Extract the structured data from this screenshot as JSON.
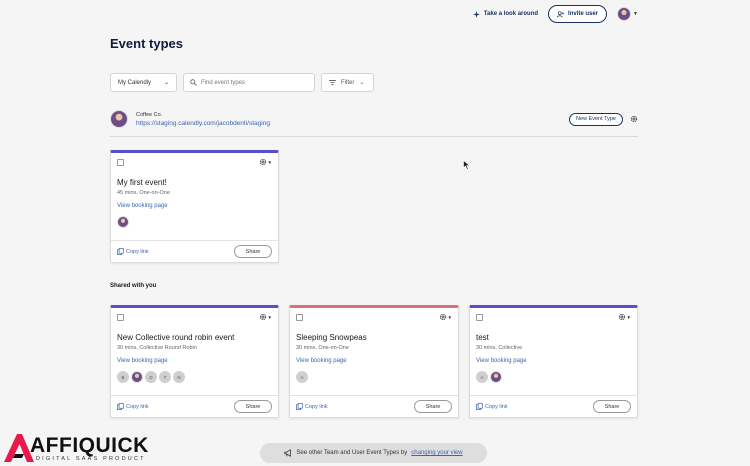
{
  "topbar": {
    "tour_label": "Take a look around",
    "invite_label": "Invite user"
  },
  "page": {
    "title": "Event types"
  },
  "filters": {
    "scope_value": "My Calendly",
    "search_placeholder": "Find event types",
    "filter_label": "Filter"
  },
  "profile": {
    "name": "Coffee Co.",
    "link": "https://staging.calendly.com/jacobdenti/staging",
    "new_event_label": "New Event Type"
  },
  "my_events": [
    {
      "title": "My first event!",
      "meta": "45 mins, One-on-One",
      "booking_label": "View booking page",
      "copy_label": "Copy link",
      "share_label": "Share",
      "accent": "#5b4fc9"
    }
  ],
  "shared": {
    "label": "Shared with you",
    "events": [
      {
        "title": "New Collective round robin event",
        "meta": "30 mins, Collective Round Robin",
        "booking_label": "View booking page",
        "people": [
          "B",
          "",
          "D",
          "T",
          "N"
        ],
        "copy_label": "Copy link",
        "share_label": "Share",
        "accent": "#5b4fc9"
      },
      {
        "title": "Sleeping Snowpeas",
        "meta": "30 mins, One-on-One",
        "booking_label": "View booking page",
        "people": [
          "A"
        ],
        "copy_label": "Copy link",
        "share_label": "Share",
        "accent": "#d9707a"
      },
      {
        "title": "test",
        "meta": "30 mins, Collective",
        "booking_label": "View booking page",
        "people": [
          "A",
          ""
        ],
        "copy_label": "Copy link",
        "share_label": "Share",
        "accent": "#5b4fc9"
      }
    ]
  },
  "toast": {
    "text": "See other Team and User Event Types by",
    "link": "changing your view"
  },
  "watermark": {
    "name": "AFFIQUICK",
    "tagline": "DIGITAL SAAS PRODUCT"
  }
}
